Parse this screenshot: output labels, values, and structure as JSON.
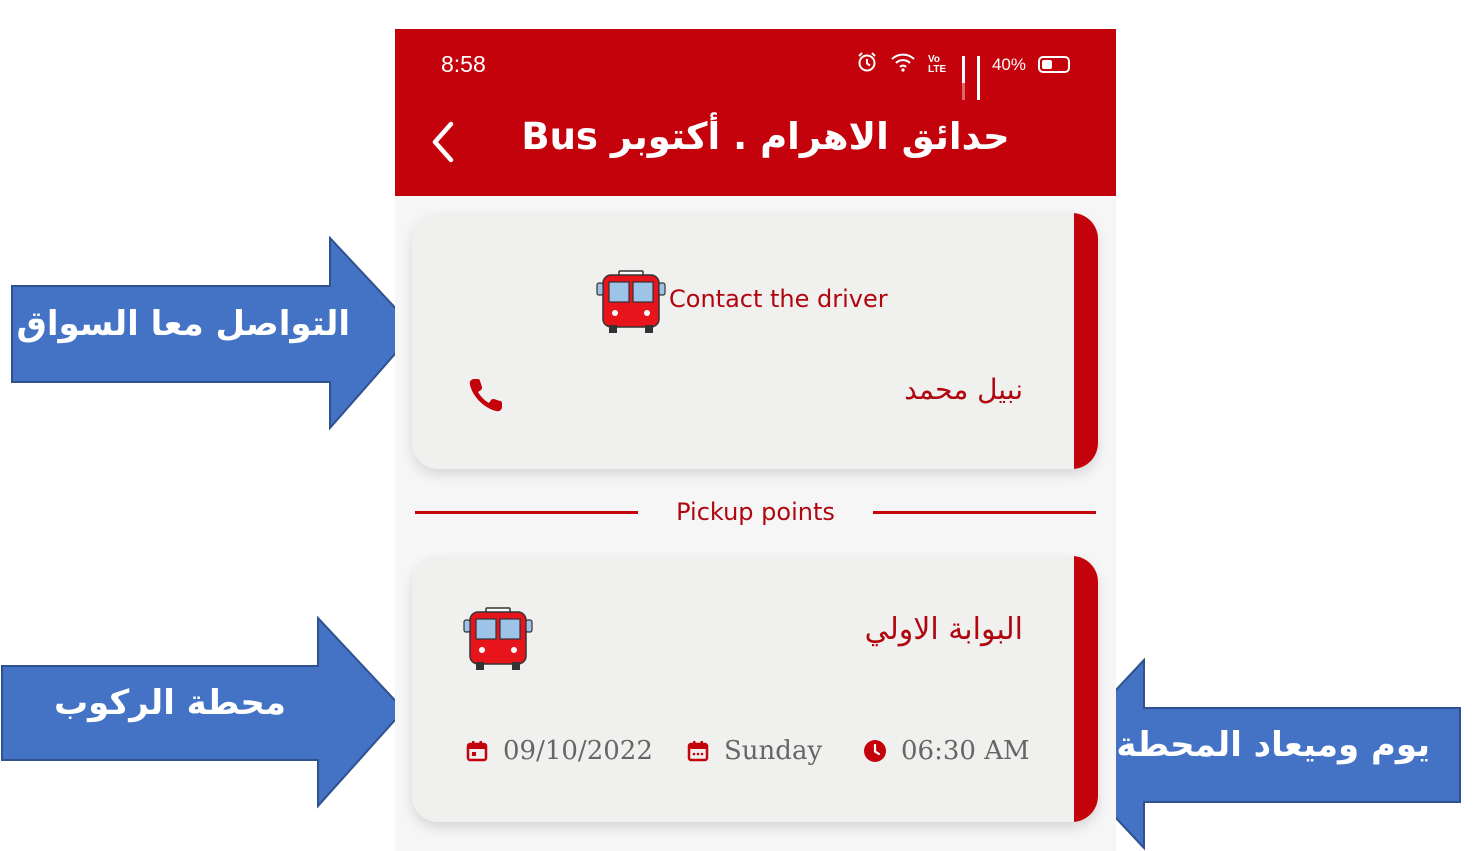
{
  "status_bar": {
    "time": "8:58",
    "battery": "40%",
    "volte": "Vo LTE"
  },
  "header": {
    "title": "حدائق الاهرام . أكتوبر Bus"
  },
  "driver_card": {
    "title": "Contact the driver",
    "driver_name": "نبيل محمد"
  },
  "section": {
    "pickup_label": "Pickup points"
  },
  "stop_card": {
    "stop_name": "البوابة الاولي",
    "date": "09/10/2022",
    "day": "Sunday",
    "time": "06:30 AM"
  },
  "annotations": {
    "contact_driver": "التواصل معا السواق",
    "pickup_station": "محطة الركوب",
    "station_day_time": "يوم وميعاد المحطة"
  },
  "colors": {
    "primary": "#c4020c",
    "arrow_fill": "#4472c4",
    "arrow_stroke": "#2f528f"
  }
}
